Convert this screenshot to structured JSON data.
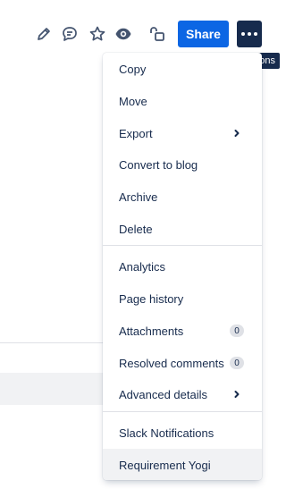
{
  "toolbar": {
    "icons": {
      "edit": "pencil-icon",
      "comment": "comment-icon",
      "star": "star-icon",
      "watch": "eye-icon",
      "restrictions": "unlock-icon"
    },
    "share_label": "Share",
    "more_label": "More actions"
  },
  "tooltip": "More actions",
  "menu": {
    "groups": [
      [
        {
          "label": "Copy"
        },
        {
          "label": "Move"
        },
        {
          "label": "Export",
          "submenu": true
        },
        {
          "label": "Convert to blog"
        },
        {
          "label": "Archive"
        },
        {
          "label": "Delete"
        }
      ],
      [
        {
          "label": "Analytics"
        },
        {
          "label": "Page history"
        },
        {
          "label": "Attachments",
          "badge": "0"
        },
        {
          "label": "Resolved comments",
          "badge": "0"
        },
        {
          "label": "Advanced details",
          "submenu": true
        }
      ],
      [
        {
          "label": "Slack Notifications"
        },
        {
          "label": "Requirement Yogi",
          "hovered": true
        }
      ]
    ]
  },
  "colors": {
    "share_bg": "#0c66e4",
    "more_bg": "#172b4d",
    "text": "#172b4d",
    "hover_bg": "#f1f2f4"
  }
}
